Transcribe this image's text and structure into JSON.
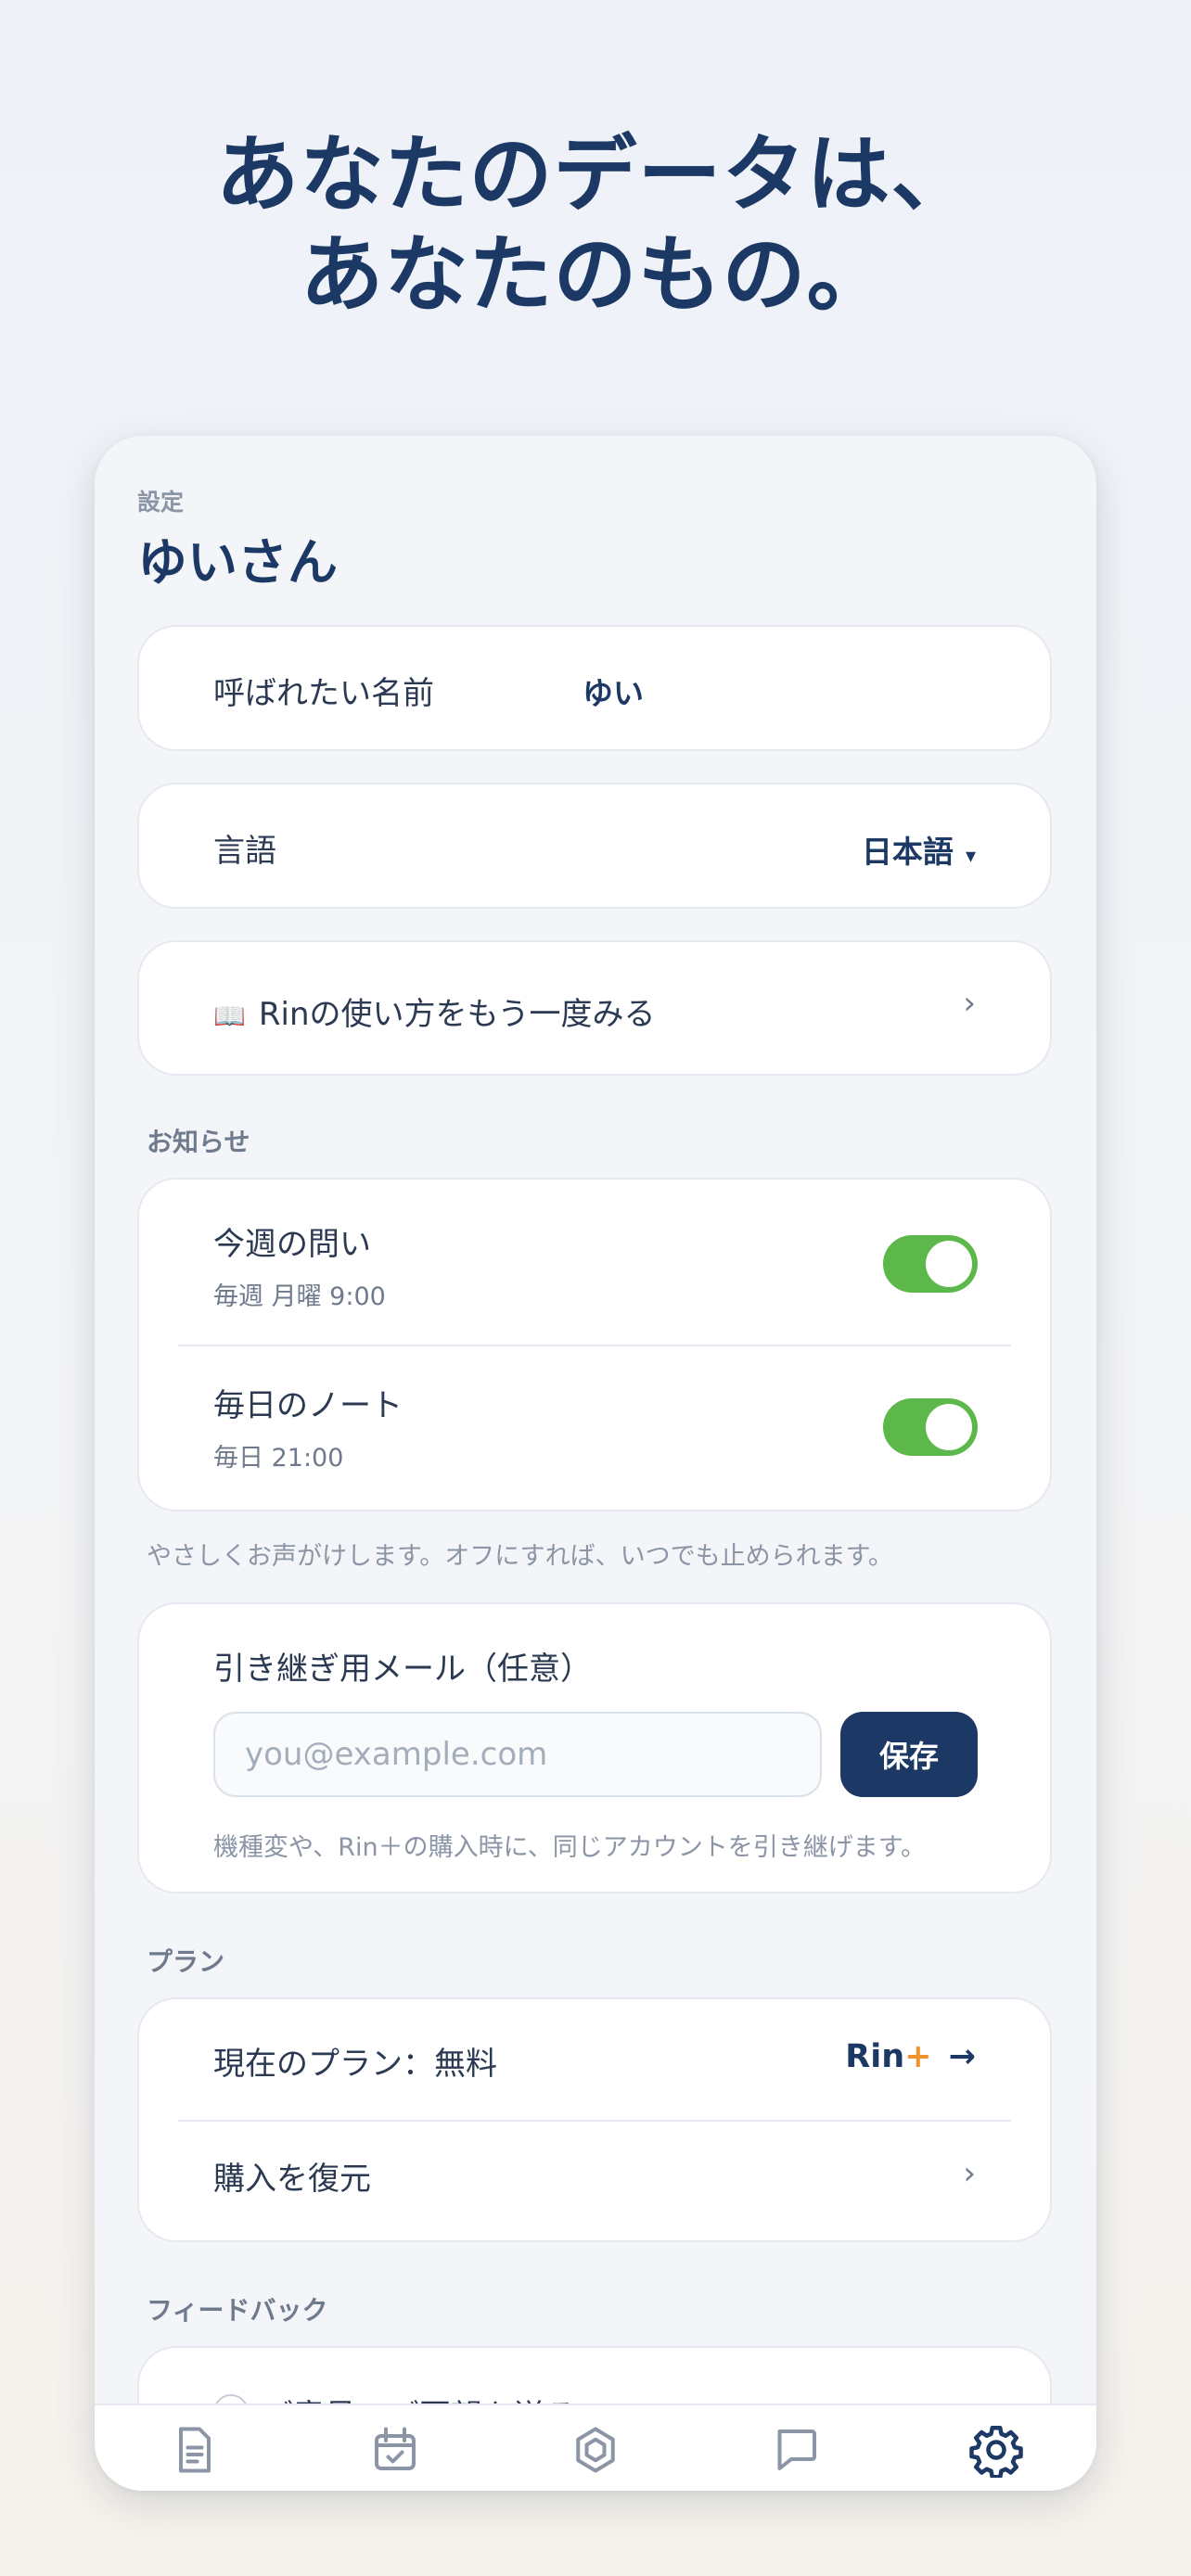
{
  "hero": {
    "line1": "あなたのデータは、",
    "line2": "あなたのもの。"
  },
  "screen": {
    "eyebrow": "設定",
    "title": "ゆいさん"
  },
  "name_row": {
    "label": "呼ばれたい名前",
    "value": "ゆい"
  },
  "language_row": {
    "label": "言語",
    "value": "日本語",
    "caret": "▾"
  },
  "tutorial_row": {
    "icon": "📖",
    "label": "Rinの使い方をもう一度みる",
    "chevron": "›"
  },
  "notifications": {
    "section": "お知らせ",
    "items": [
      {
        "title": "今週の問い",
        "schedule": "毎週 月曜 9:00",
        "enabled": true
      },
      {
        "title": "毎日のノート",
        "schedule": "毎日 21:00",
        "enabled": true
      }
    ],
    "note": "やさしくお声がけします。オフにすれば、いつでも止められます。"
  },
  "email": {
    "title": "引き継ぎ用メール（任意）",
    "placeholder": "you@example.com",
    "save_label": "保存",
    "note": "機種変や、Rin＋の購入時に、同じアカウントを引き継げます。"
  },
  "plan": {
    "section": "プラン",
    "current_label": "現在のプラン：無料",
    "upgrade_brand": "Rin",
    "upgrade_plus": "+",
    "upgrade_arrow": "→",
    "restore_label": "購入を復元",
    "restore_chevron": "›"
  },
  "feedback": {
    "section": "フィードバック",
    "partial_item": "ご意見・ご要望を送る"
  },
  "tabs": [
    {
      "icon": "document-icon",
      "active": false
    },
    {
      "icon": "calendar-check-icon",
      "active": false
    },
    {
      "icon": "hexagon-icon",
      "active": false
    },
    {
      "icon": "chat-bubble-icon",
      "active": false
    },
    {
      "icon": "gear-icon",
      "active": true
    }
  ],
  "colors": {
    "brand_navy": "#1c3864",
    "toggle_on": "#5cb84a",
    "accent_orange": "#f0932b"
  }
}
